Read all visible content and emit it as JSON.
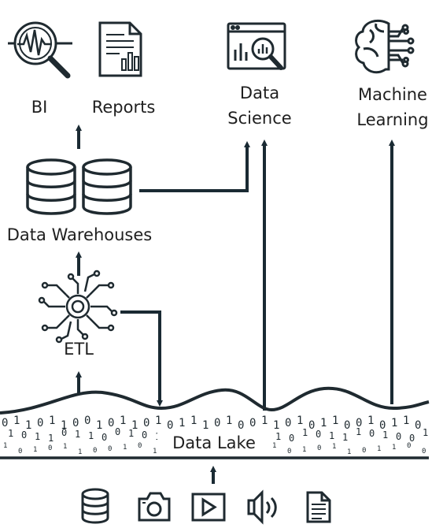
{
  "labels": {
    "bi": "BI",
    "reports": "Reports",
    "data_science": [
      "Data",
      "Science"
    ],
    "machine_learning": [
      "Machine",
      "Learning"
    ],
    "data_warehouses": "Data Warehouses",
    "etl": "ETL",
    "data_lake": "Data Lake"
  },
  "icons": {
    "top": [
      "bi-analytics-icon",
      "report-document-icon",
      "data-science-dashboard-icon",
      "ai-brain-icon"
    ],
    "middle": [
      "database-icon",
      "database-icon",
      "etl-chip-gear-icon"
    ],
    "sources": [
      "database-source-icon",
      "camera-source-icon",
      "video-source-icon",
      "audio-source-icon",
      "document-source-icon"
    ]
  },
  "binary_stream": "0 1 1 0 1 1 0 0 1 0 1 1 0 1 0 1 1 1 0 1 0 0 1 1 0 1 0 1 1 0 0 1 0 1 1 0 1",
  "colors": {
    "ink": "#1f2a30",
    "line": "#1a2a33"
  }
}
